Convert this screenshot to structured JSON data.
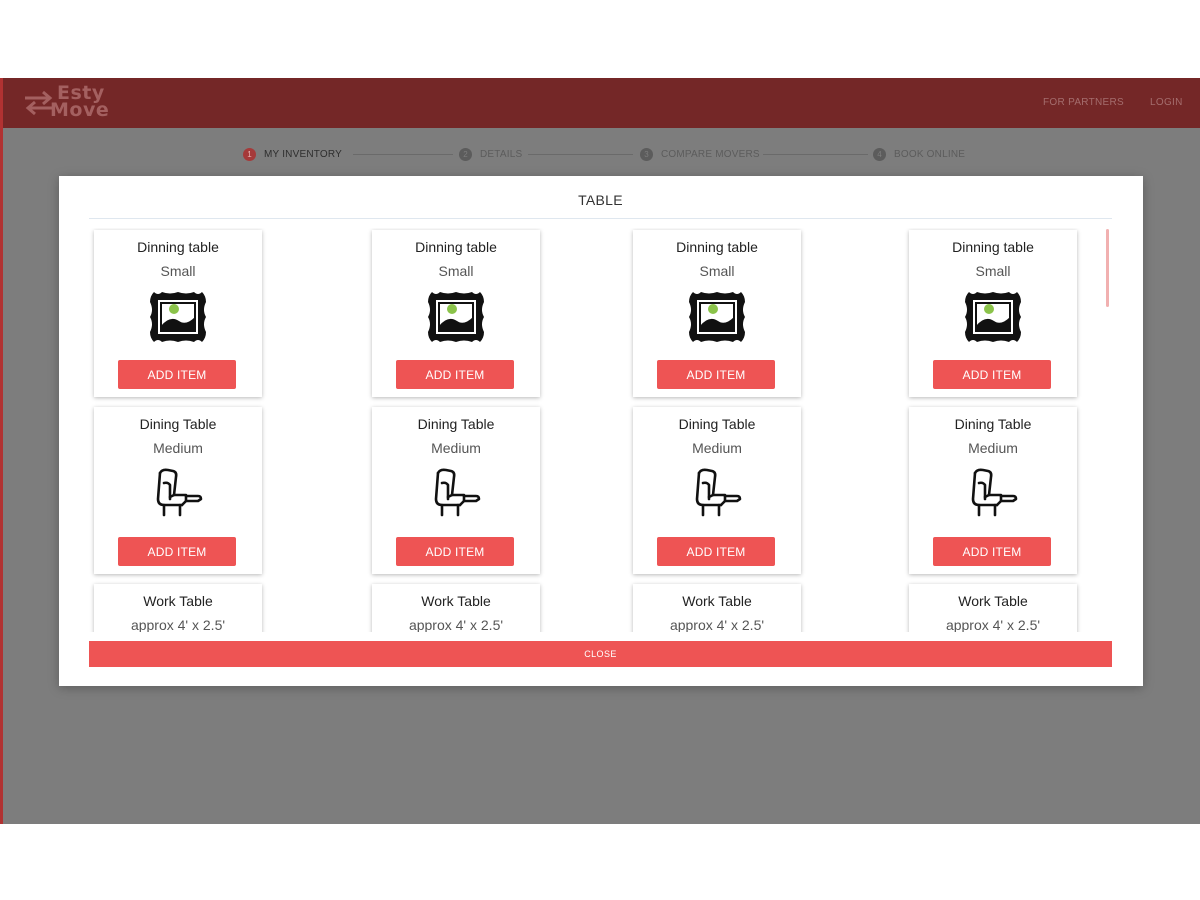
{
  "brand": {
    "logo_line1": "Esty",
    "logo_line2": "Move",
    "tagline": ""
  },
  "topnav": {
    "partners": "FOR PARTNERS",
    "login": "LOGIN"
  },
  "steps": [
    {
      "num": "1",
      "label": "MY INVENTORY",
      "active": true
    },
    {
      "num": "2",
      "label": "DETAILS",
      "active": false
    },
    {
      "num": "3",
      "label": "COMPARE MOVERS",
      "active": false
    },
    {
      "num": "4",
      "label": "BOOK ONLINE",
      "active": false
    }
  ],
  "modal": {
    "title": "TABLE",
    "close_label": "CLOSE",
    "add_label": "ADD ITEM",
    "columns": 4,
    "items": [
      {
        "name": "Dinning table",
        "size": "Small",
        "icon": "picture-frame-icon"
      },
      {
        "name": "Dinning table",
        "size": "Small",
        "icon": "picture-frame-icon"
      },
      {
        "name": "Dinning table",
        "size": "Small",
        "icon": "picture-frame-icon"
      },
      {
        "name": "Dinning table",
        "size": "Small",
        "icon": "picture-frame-icon"
      },
      {
        "name": "Dining Table",
        "size": "Medium",
        "icon": "recliner-chair-icon"
      },
      {
        "name": "Dining Table",
        "size": "Medium",
        "icon": "recliner-chair-icon"
      },
      {
        "name": "Dining Table",
        "size": "Medium",
        "icon": "recliner-chair-icon"
      },
      {
        "name": "Dining Table",
        "size": "Medium",
        "icon": "recliner-chair-icon"
      },
      {
        "name": "Work Table",
        "size": "approx 4' x 2.5'",
        "icon": "recliner-chair-icon"
      },
      {
        "name": "Work Table",
        "size": "approx 4' x 2.5'",
        "icon": "recliner-chair-icon"
      },
      {
        "name": "Work Table",
        "size": "approx 4' x 2.5'",
        "icon": "recliner-chair-icon"
      },
      {
        "name": "Work Table",
        "size": "approx 4' x 2.5'",
        "icon": "recliner-chair-icon"
      }
    ]
  },
  "colors": {
    "brand_red": "#742727",
    "button_red": "#ee5454",
    "overlay_gray": "#7d7d7d"
  }
}
